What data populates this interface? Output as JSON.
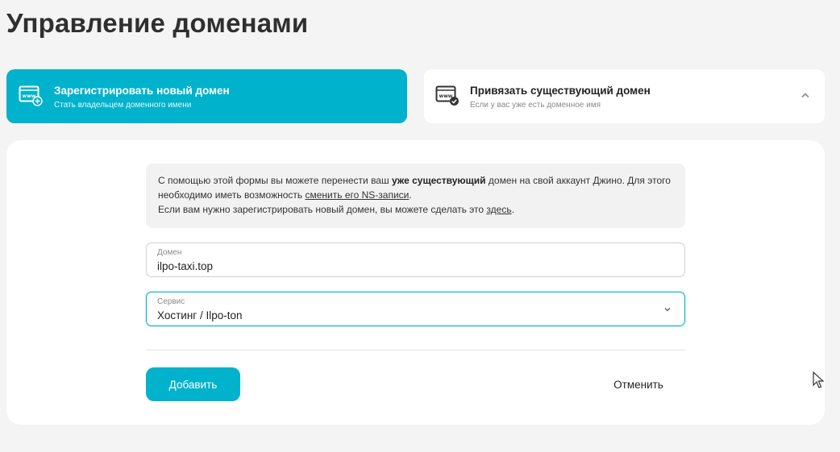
{
  "page": {
    "title": "Управление доменами"
  },
  "options": {
    "register": {
      "title": "Зарегистрировать новый домен",
      "subtitle": "Стать владельцем доменного имени",
      "icon": "www-plus-icon",
      "active": true
    },
    "bind": {
      "title": "Привязать существующий домен",
      "subtitle": "Если у вас уже есть доменное имя",
      "icon": "www-check-icon",
      "toggle_icon": "chevron-up-icon"
    }
  },
  "info": {
    "part1": "С помощью этой формы вы можете перенести ваш ",
    "bold": "уже существующий",
    "part2": " домен на свой аккаунт Джино. Для этого необходимо иметь возможность ",
    "link_ns": "сменить его NS-записи",
    "part3": ".",
    "part4": "Если вам нужно зарегистрировать новый домен, вы можете сделать это ",
    "link_here": "здесь",
    "part5": "."
  },
  "form": {
    "domain": {
      "label": "Домен",
      "value": "ilpo-taxi.top"
    },
    "service": {
      "label": "Сервис",
      "value": "Хостинг / Ilpo-ton",
      "icon": "chevron-down-icon"
    }
  },
  "actions": {
    "add_label": "Добавить",
    "cancel_label": "Отменить"
  },
  "colors": {
    "accent": "#00b2cc",
    "background": "#f4f4f4",
    "panel": "#ffffff"
  }
}
